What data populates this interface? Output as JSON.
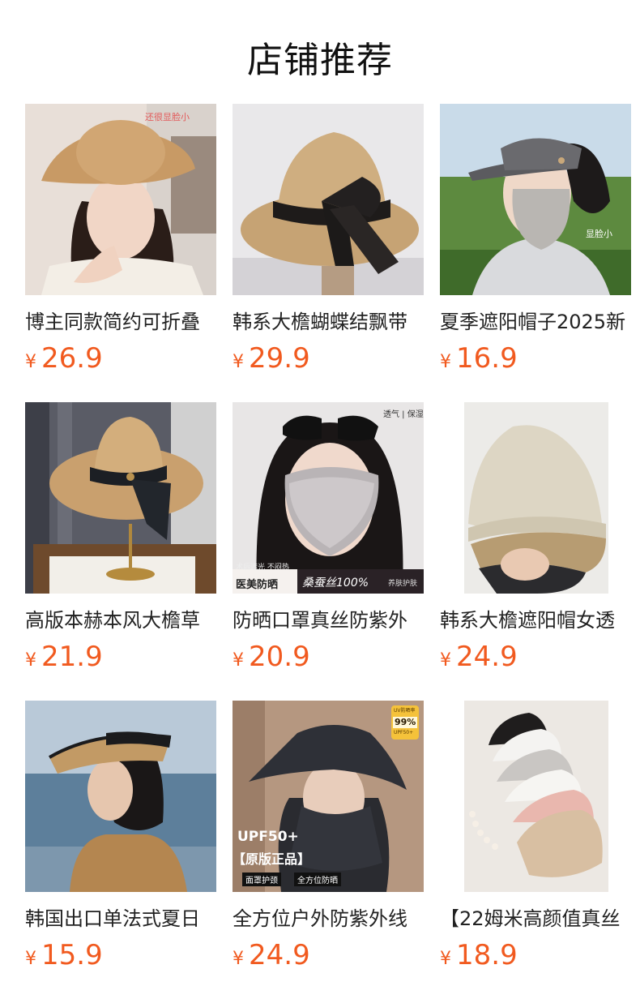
{
  "page_title": "店铺推荐",
  "currency_symbol": "¥",
  "accent_color": "#f15a1f",
  "products": [
    {
      "name": "博主同款简约可折叠",
      "price": "26.9",
      "badge": "还很显脸小"
    },
    {
      "name": "韩系大檐蝴蝶结飘带",
      "price": "29.9"
    },
    {
      "name": "夏季遮阳帽子2025新",
      "price": "16.9",
      "badge": "显脸小"
    },
    {
      "name": "高版本赫本风大檐草",
      "price": "21.9"
    },
    {
      "name": "防晒口罩真丝防紫外",
      "price": "20.9",
      "tag_top": "透气 | 保湿",
      "tag_note": "术后遮光 不闷热",
      "tag_left": "医美防晒",
      "tag_right": "桑蚕丝100%",
      "tag_small": "养肤护肤"
    },
    {
      "name": "韩系大檐遮阳帽女透",
      "price": "24.9"
    },
    {
      "name": "韩国出口单法式夏日",
      "price": "15.9"
    },
    {
      "name": "全方位户外防紫外线",
      "price": "24.9",
      "upf": "UPF50+",
      "genuine": "【原版正品】",
      "tag_a": "面罩护颈",
      "tag_b": "全方位防晒",
      "badge_pct": "99%",
      "badge_top": "UV防晒率",
      "badge_bottom": "UPF50+"
    },
    {
      "name": "【22姆米高颜值真丝",
      "price": "18.9"
    }
  ]
}
